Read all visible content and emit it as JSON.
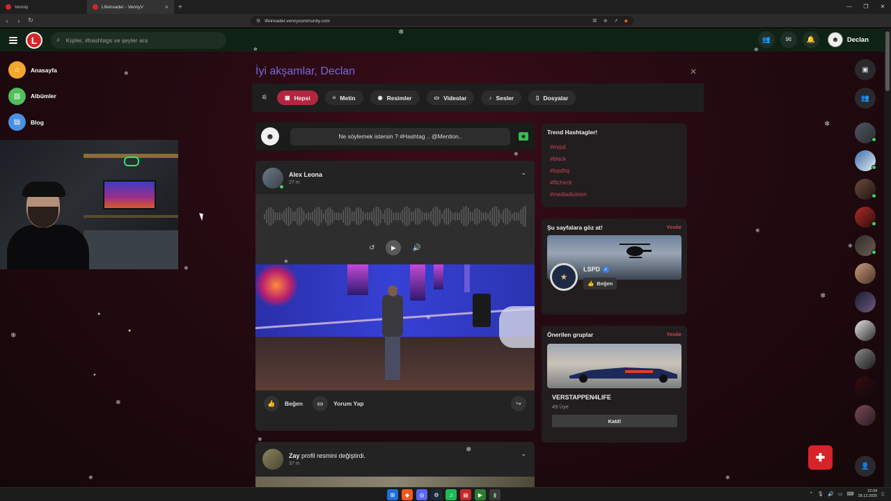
{
  "browser": {
    "tabs": [
      {
        "title": "Venniy",
        "active": false
      },
      {
        "title": "Lifeinvader - VennyV",
        "active": true
      }
    ],
    "url": "lifeinvader.vennycommunity.com"
  },
  "header": {
    "logo_letter": "L",
    "search_placeholder": "Kişiler, #hashtags ve şeyler ara",
    "user_name": "Declan"
  },
  "sidebar": {
    "items": [
      {
        "label": "Anasayfa",
        "icon": "home-icon",
        "color": "#f3a82b"
      },
      {
        "label": "Albümler",
        "icon": "album-icon",
        "color": "#4fbf5a"
      },
      {
        "label": "Blog",
        "icon": "blog-icon",
        "color": "#4a90e2"
      }
    ]
  },
  "feed": {
    "greeting": "İyi akşamlar, Declan",
    "filters": [
      {
        "label": "Hepsi",
        "icon": "all-icon",
        "active": true
      },
      {
        "label": "Metin",
        "icon": "text-icon",
        "active": false
      },
      {
        "label": "Resimler",
        "icon": "camera-icon",
        "active": false
      },
      {
        "label": "Videolar",
        "icon": "video-icon",
        "active": false
      },
      {
        "label": "Sesler",
        "icon": "music-icon",
        "active": false
      },
      {
        "label": "Dosyalar",
        "icon": "file-icon",
        "active": false
      }
    ],
    "composer_placeholder": "Ne söylemek istersin ? #Hashtag .. @Mention..",
    "posts": [
      {
        "author": "Alex Leona",
        "time": "27 m",
        "like_label": "Beğen",
        "comment_label": "Yorum Yap"
      },
      {
        "author": "Zay",
        "action": "profil resmini değiştirdi.",
        "time": "37 m"
      }
    ]
  },
  "widgets": {
    "trending": {
      "title": "Trend Hashtagler!",
      "tags": [
        "#mrpd",
        "#black",
        "#lspdhq",
        "#fitcheck",
        "#mediadivision"
      ]
    },
    "pages": {
      "title": "Şu sayfalara göz at!",
      "refresh": "Yenile",
      "page_name": "LSPD",
      "like_label": "Beğen"
    },
    "groups": {
      "title": "Önerilen gruplar",
      "refresh": "Yenile",
      "group_name": "VERSTAPPEN4LIFE",
      "members": "49 Üye",
      "join_label": "Katıl!"
    }
  },
  "taskbar": {
    "time": "22:09",
    "date": "28.12.2025"
  },
  "colors": {
    "accent": "#d8232a",
    "active_filter": "#b3263f",
    "hashtag": "#c9455a",
    "greeting": "#7b68d9",
    "header_bg": "#0f2216",
    "online": "#3cd35a"
  }
}
